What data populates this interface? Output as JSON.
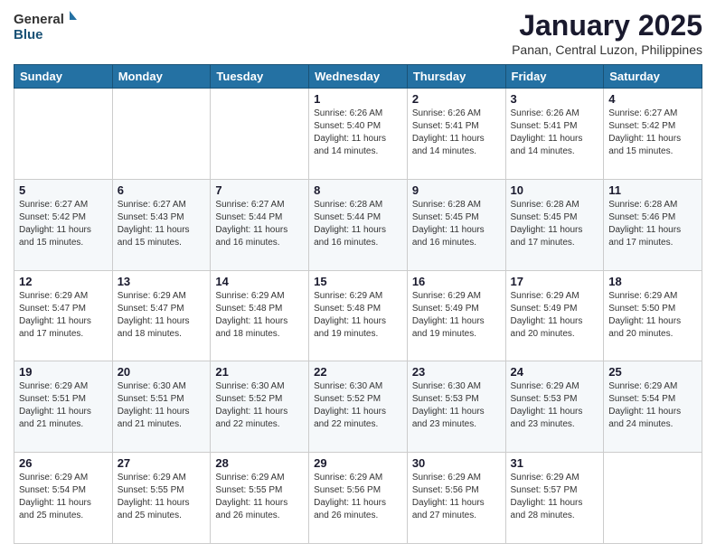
{
  "header": {
    "logo_general": "General",
    "logo_blue": "Blue",
    "title": "January 2025",
    "subtitle": "Panan, Central Luzon, Philippines"
  },
  "calendar": {
    "days_of_week": [
      "Sunday",
      "Monday",
      "Tuesday",
      "Wednesday",
      "Thursday",
      "Friday",
      "Saturday"
    ],
    "weeks": [
      [
        {
          "day": "",
          "info": ""
        },
        {
          "day": "",
          "info": ""
        },
        {
          "day": "",
          "info": ""
        },
        {
          "day": "1",
          "info": "Sunrise: 6:26 AM\nSunset: 5:40 PM\nDaylight: 11 hours and 14 minutes."
        },
        {
          "day": "2",
          "info": "Sunrise: 6:26 AM\nSunset: 5:41 PM\nDaylight: 11 hours and 14 minutes."
        },
        {
          "day": "3",
          "info": "Sunrise: 6:26 AM\nSunset: 5:41 PM\nDaylight: 11 hours and 14 minutes."
        },
        {
          "day": "4",
          "info": "Sunrise: 6:27 AM\nSunset: 5:42 PM\nDaylight: 11 hours and 15 minutes."
        }
      ],
      [
        {
          "day": "5",
          "info": "Sunrise: 6:27 AM\nSunset: 5:42 PM\nDaylight: 11 hours and 15 minutes."
        },
        {
          "day": "6",
          "info": "Sunrise: 6:27 AM\nSunset: 5:43 PM\nDaylight: 11 hours and 15 minutes."
        },
        {
          "day": "7",
          "info": "Sunrise: 6:27 AM\nSunset: 5:44 PM\nDaylight: 11 hours and 16 minutes."
        },
        {
          "day": "8",
          "info": "Sunrise: 6:28 AM\nSunset: 5:44 PM\nDaylight: 11 hours and 16 minutes."
        },
        {
          "day": "9",
          "info": "Sunrise: 6:28 AM\nSunset: 5:45 PM\nDaylight: 11 hours and 16 minutes."
        },
        {
          "day": "10",
          "info": "Sunrise: 6:28 AM\nSunset: 5:45 PM\nDaylight: 11 hours and 17 minutes."
        },
        {
          "day": "11",
          "info": "Sunrise: 6:28 AM\nSunset: 5:46 PM\nDaylight: 11 hours and 17 minutes."
        }
      ],
      [
        {
          "day": "12",
          "info": "Sunrise: 6:29 AM\nSunset: 5:47 PM\nDaylight: 11 hours and 17 minutes."
        },
        {
          "day": "13",
          "info": "Sunrise: 6:29 AM\nSunset: 5:47 PM\nDaylight: 11 hours and 18 minutes."
        },
        {
          "day": "14",
          "info": "Sunrise: 6:29 AM\nSunset: 5:48 PM\nDaylight: 11 hours and 18 minutes."
        },
        {
          "day": "15",
          "info": "Sunrise: 6:29 AM\nSunset: 5:48 PM\nDaylight: 11 hours and 19 minutes."
        },
        {
          "day": "16",
          "info": "Sunrise: 6:29 AM\nSunset: 5:49 PM\nDaylight: 11 hours and 19 minutes."
        },
        {
          "day": "17",
          "info": "Sunrise: 6:29 AM\nSunset: 5:49 PM\nDaylight: 11 hours and 20 minutes."
        },
        {
          "day": "18",
          "info": "Sunrise: 6:29 AM\nSunset: 5:50 PM\nDaylight: 11 hours and 20 minutes."
        }
      ],
      [
        {
          "day": "19",
          "info": "Sunrise: 6:29 AM\nSunset: 5:51 PM\nDaylight: 11 hours and 21 minutes."
        },
        {
          "day": "20",
          "info": "Sunrise: 6:30 AM\nSunset: 5:51 PM\nDaylight: 11 hours and 21 minutes."
        },
        {
          "day": "21",
          "info": "Sunrise: 6:30 AM\nSunset: 5:52 PM\nDaylight: 11 hours and 22 minutes."
        },
        {
          "day": "22",
          "info": "Sunrise: 6:30 AM\nSunset: 5:52 PM\nDaylight: 11 hours and 22 minutes."
        },
        {
          "day": "23",
          "info": "Sunrise: 6:30 AM\nSunset: 5:53 PM\nDaylight: 11 hours and 23 minutes."
        },
        {
          "day": "24",
          "info": "Sunrise: 6:29 AM\nSunset: 5:53 PM\nDaylight: 11 hours and 23 minutes."
        },
        {
          "day": "25",
          "info": "Sunrise: 6:29 AM\nSunset: 5:54 PM\nDaylight: 11 hours and 24 minutes."
        }
      ],
      [
        {
          "day": "26",
          "info": "Sunrise: 6:29 AM\nSunset: 5:54 PM\nDaylight: 11 hours and 25 minutes."
        },
        {
          "day": "27",
          "info": "Sunrise: 6:29 AM\nSunset: 5:55 PM\nDaylight: 11 hours and 25 minutes."
        },
        {
          "day": "28",
          "info": "Sunrise: 6:29 AM\nSunset: 5:55 PM\nDaylight: 11 hours and 26 minutes."
        },
        {
          "day": "29",
          "info": "Sunrise: 6:29 AM\nSunset: 5:56 PM\nDaylight: 11 hours and 26 minutes."
        },
        {
          "day": "30",
          "info": "Sunrise: 6:29 AM\nSunset: 5:56 PM\nDaylight: 11 hours and 27 minutes."
        },
        {
          "day": "31",
          "info": "Sunrise: 6:29 AM\nSunset: 5:57 PM\nDaylight: 11 hours and 28 minutes."
        },
        {
          "day": "",
          "info": ""
        }
      ]
    ]
  }
}
